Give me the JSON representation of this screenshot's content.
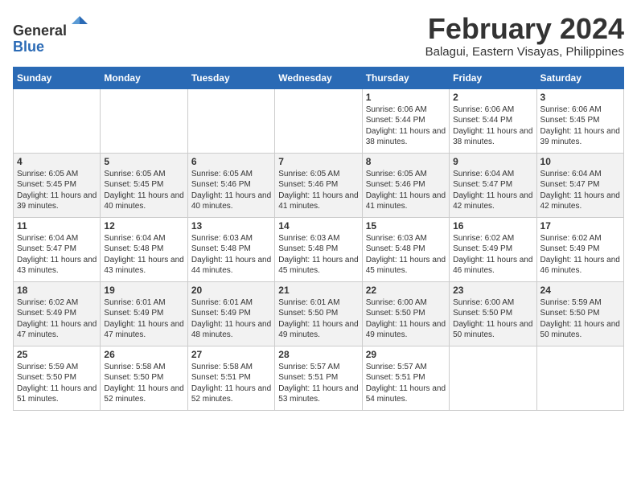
{
  "header": {
    "logo_line1": "General",
    "logo_line2": "Blue",
    "title": "February 2024",
    "subtitle": "Balagui, Eastern Visayas, Philippines"
  },
  "columns": [
    "Sunday",
    "Monday",
    "Tuesday",
    "Wednesday",
    "Thursday",
    "Friday",
    "Saturday"
  ],
  "weeks": [
    [
      {
        "day": "",
        "info": ""
      },
      {
        "day": "",
        "info": ""
      },
      {
        "day": "",
        "info": ""
      },
      {
        "day": "",
        "info": ""
      },
      {
        "day": "1",
        "info": "Sunrise: 6:06 AM\nSunset: 5:44 PM\nDaylight: 11 hours\nand 38 minutes."
      },
      {
        "day": "2",
        "info": "Sunrise: 6:06 AM\nSunset: 5:44 PM\nDaylight: 11 hours\nand 38 minutes."
      },
      {
        "day": "3",
        "info": "Sunrise: 6:06 AM\nSunset: 5:45 PM\nDaylight: 11 hours\nand 39 minutes."
      }
    ],
    [
      {
        "day": "4",
        "info": "Sunrise: 6:05 AM\nSunset: 5:45 PM\nDaylight: 11 hours\nand 39 minutes."
      },
      {
        "day": "5",
        "info": "Sunrise: 6:05 AM\nSunset: 5:45 PM\nDaylight: 11 hours\nand 40 minutes."
      },
      {
        "day": "6",
        "info": "Sunrise: 6:05 AM\nSunset: 5:46 PM\nDaylight: 11 hours\nand 40 minutes."
      },
      {
        "day": "7",
        "info": "Sunrise: 6:05 AM\nSunset: 5:46 PM\nDaylight: 11 hours\nand 41 minutes."
      },
      {
        "day": "8",
        "info": "Sunrise: 6:05 AM\nSunset: 5:46 PM\nDaylight: 11 hours\nand 41 minutes."
      },
      {
        "day": "9",
        "info": "Sunrise: 6:04 AM\nSunset: 5:47 PM\nDaylight: 11 hours\nand 42 minutes."
      },
      {
        "day": "10",
        "info": "Sunrise: 6:04 AM\nSunset: 5:47 PM\nDaylight: 11 hours\nand 42 minutes."
      }
    ],
    [
      {
        "day": "11",
        "info": "Sunrise: 6:04 AM\nSunset: 5:47 PM\nDaylight: 11 hours\nand 43 minutes."
      },
      {
        "day": "12",
        "info": "Sunrise: 6:04 AM\nSunset: 5:48 PM\nDaylight: 11 hours\nand 43 minutes."
      },
      {
        "day": "13",
        "info": "Sunrise: 6:03 AM\nSunset: 5:48 PM\nDaylight: 11 hours\nand 44 minutes."
      },
      {
        "day": "14",
        "info": "Sunrise: 6:03 AM\nSunset: 5:48 PM\nDaylight: 11 hours\nand 45 minutes."
      },
      {
        "day": "15",
        "info": "Sunrise: 6:03 AM\nSunset: 5:48 PM\nDaylight: 11 hours\nand 45 minutes."
      },
      {
        "day": "16",
        "info": "Sunrise: 6:02 AM\nSunset: 5:49 PM\nDaylight: 11 hours\nand 46 minutes."
      },
      {
        "day": "17",
        "info": "Sunrise: 6:02 AM\nSunset: 5:49 PM\nDaylight: 11 hours\nand 46 minutes."
      }
    ],
    [
      {
        "day": "18",
        "info": "Sunrise: 6:02 AM\nSunset: 5:49 PM\nDaylight: 11 hours\nand 47 minutes."
      },
      {
        "day": "19",
        "info": "Sunrise: 6:01 AM\nSunset: 5:49 PM\nDaylight: 11 hours\nand 47 minutes."
      },
      {
        "day": "20",
        "info": "Sunrise: 6:01 AM\nSunset: 5:49 PM\nDaylight: 11 hours\nand 48 minutes."
      },
      {
        "day": "21",
        "info": "Sunrise: 6:01 AM\nSunset: 5:50 PM\nDaylight: 11 hours\nand 49 minutes."
      },
      {
        "day": "22",
        "info": "Sunrise: 6:00 AM\nSunset: 5:50 PM\nDaylight: 11 hours\nand 49 minutes."
      },
      {
        "day": "23",
        "info": "Sunrise: 6:00 AM\nSunset: 5:50 PM\nDaylight: 11 hours\nand 50 minutes."
      },
      {
        "day": "24",
        "info": "Sunrise: 5:59 AM\nSunset: 5:50 PM\nDaylight: 11 hours\nand 50 minutes."
      }
    ],
    [
      {
        "day": "25",
        "info": "Sunrise: 5:59 AM\nSunset: 5:50 PM\nDaylight: 11 hours\nand 51 minutes."
      },
      {
        "day": "26",
        "info": "Sunrise: 5:58 AM\nSunset: 5:50 PM\nDaylight: 11 hours\nand 52 minutes."
      },
      {
        "day": "27",
        "info": "Sunrise: 5:58 AM\nSunset: 5:51 PM\nDaylight: 11 hours\nand 52 minutes."
      },
      {
        "day": "28",
        "info": "Sunrise: 5:57 AM\nSunset: 5:51 PM\nDaylight: 11 hours\nand 53 minutes."
      },
      {
        "day": "29",
        "info": "Sunrise: 5:57 AM\nSunset: 5:51 PM\nDaylight: 11 hours\nand 54 minutes."
      },
      {
        "day": "",
        "info": ""
      },
      {
        "day": "",
        "info": ""
      }
    ]
  ]
}
